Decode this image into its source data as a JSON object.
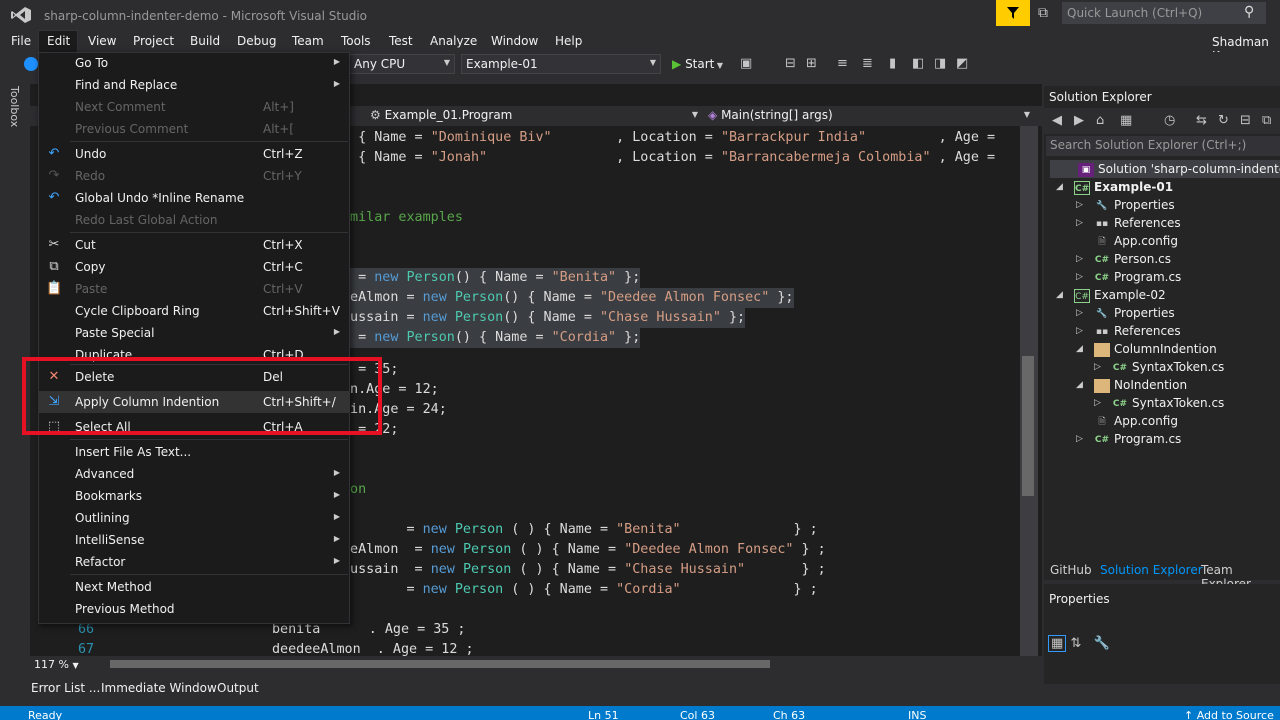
{
  "window": {
    "title": "sharp-column-indenter-demo - Microsoft Visual Studio",
    "quick_launch_placeholder": "Quick Launch (Ctrl+Q)",
    "user": "Shadman Ku"
  },
  "menubar": [
    "File",
    "Edit",
    "View",
    "Project",
    "Build",
    "Debug",
    "Team",
    "Tools",
    "Test",
    "Analyze",
    "Window",
    "Help"
  ],
  "toolbar": {
    "platform": "Any CPU",
    "startup_project": "Example-01",
    "start_label": "Start"
  },
  "left_rail": {
    "toolbox": "Toolbox"
  },
  "editor": {
    "nav_class": "Example_01.Program",
    "nav_member": "Main(string[] args)",
    "zoom": "117 %"
  },
  "code_lines": [
    {
      "n": "",
      "parts": [
        [
          "pl",
          "n { Name = "
        ],
        [
          "str",
          "\"Dominique Biv\""
        ],
        [
          "pl",
          "        , Location = "
        ],
        [
          "str",
          "\"Barrackpur India\""
        ],
        [
          "pl",
          "         , Age ="
        ]
      ]
    },
    {
      "n": "",
      "parts": [
        [
          "pl",
          "n { Name = "
        ],
        [
          "str",
          "\"Jonah\""
        ],
        [
          "pl",
          "                , Location = "
        ],
        [
          "str",
          "\"Barrancabermeja Colombia\""
        ],
        [
          "pl",
          " , Age ="
        ]
      ]
    },
    {
      "n": "",
      "parts": [
        [
          "cmt",
          "imilar examples"
        ]
      ]
    },
    {
      "n": "",
      "parts": [
        [
          "cmt",
          "n"
        ]
      ]
    },
    {
      "n": "",
      "parts": [
        [
          "pl",
          "a = "
        ],
        [
          "kw",
          "new"
        ],
        [
          "pl",
          " "
        ],
        [
          "ty",
          "Person"
        ],
        [
          "pl",
          "() { Name = "
        ],
        [
          "str",
          "\"Benita\""
        ],
        [
          "pl",
          " };"
        ]
      ]
    },
    {
      "n": "",
      "parts": [
        [
          "pl",
          "eeAlmon = "
        ],
        [
          "kw",
          "new"
        ],
        [
          "pl",
          " "
        ],
        [
          "ty",
          "Person"
        ],
        [
          "pl",
          "() { Name = "
        ],
        [
          "str",
          "\"Deedee Almon Fonsec\""
        ],
        [
          "pl",
          " };"
        ]
      ]
    },
    {
      "n": "",
      "parts": [
        [
          "pl",
          "Hussain = "
        ],
        [
          "kw",
          "new"
        ],
        [
          "pl",
          " "
        ],
        [
          "ty",
          "Person"
        ],
        [
          "pl",
          "() { Name = "
        ],
        [
          "str",
          "\"Chase Hussain\""
        ],
        [
          "pl",
          " };"
        ]
      ]
    },
    {
      "n": "",
      "parts": [
        [
          "pl",
          "a = "
        ],
        [
          "kw",
          "new"
        ],
        [
          "pl",
          " "
        ],
        [
          "ty",
          "Person"
        ],
        [
          "pl",
          "() { Name = "
        ],
        [
          "str",
          "\"Cordia\""
        ],
        [
          "pl",
          " };"
        ]
      ]
    },
    {
      "n": "",
      "parts": [
        [
          "pl",
          "e = 35;"
        ]
      ]
    },
    {
      "n": "",
      "parts": [
        [
          "pl",
          "on.Age = 12;"
        ]
      ]
    },
    {
      "n": "",
      "parts": [
        [
          "pl",
          "ain.Age = 24;"
        ]
      ]
    },
    {
      "n": "",
      "parts": [
        [
          "pl",
          "e = 22;"
        ]
      ]
    },
    {
      "n": "",
      "parts": [
        [
          "cmt",
          "ion"
        ]
      ]
    },
    {
      "n": "",
      "parts": [
        [
          "pl",
          "a       = "
        ],
        [
          "kw",
          "new"
        ],
        [
          "pl",
          " "
        ],
        [
          "ty",
          "Person"
        ],
        [
          "pl",
          " ( ) { Name = "
        ],
        [
          "str",
          "\"Benita\""
        ],
        [
          "pl",
          "              } ;"
        ]
      ]
    },
    {
      "n": "",
      "parts": [
        [
          "pl",
          "eeAlmon  = "
        ],
        [
          "kw",
          "new"
        ],
        [
          "pl",
          " "
        ],
        [
          "ty",
          "Person"
        ],
        [
          "pl",
          " ( ) { Name = "
        ],
        [
          "str",
          "\"Deedee Almon Fonsec\""
        ],
        [
          "pl",
          " } ;"
        ]
      ]
    },
    {
      "n": "",
      "parts": [
        [
          "pl",
          "Hussain  = "
        ],
        [
          "kw",
          "new"
        ],
        [
          "pl",
          " "
        ],
        [
          "ty",
          "Person"
        ],
        [
          "pl",
          " ( ) { Name = "
        ],
        [
          "str",
          "\"Chase Hussain\""
        ],
        [
          "pl",
          "       } ;"
        ]
      ]
    },
    {
      "n": "",
      "parts": [
        [
          "pl",
          "a       = "
        ],
        [
          "kw",
          "new"
        ],
        [
          "pl",
          " "
        ],
        [
          "ty",
          "Person"
        ],
        [
          "pl",
          " ( ) { Name = "
        ],
        [
          "str",
          "\"Cordia\""
        ],
        [
          "pl",
          "              } ;"
        ]
      ]
    },
    {
      "n": "66",
      "parts": [
        [
          "pl",
          "benita      . Age = 35 ;"
        ]
      ]
    },
    {
      "n": "67",
      "parts": [
        [
          "pl",
          "deedeeAlmon  . Age = 12 ;"
        ]
      ]
    }
  ],
  "edit_menu": {
    "items": [
      {
        "label": "Go To",
        "shortcut": "",
        "sub": true,
        "disabled": false,
        "icon": ""
      },
      {
        "label": "Find and Replace",
        "shortcut": "",
        "sub": true,
        "disabled": false,
        "icon": ""
      },
      {
        "label": "Next Comment",
        "shortcut": "Alt+]",
        "sub": false,
        "disabled": true,
        "icon": ""
      },
      {
        "label": "Previous Comment",
        "shortcut": "Alt+[",
        "sub": false,
        "disabled": true,
        "icon": ""
      },
      {
        "label": "Undo",
        "shortcut": "Ctrl+Z",
        "sub": false,
        "disabled": false,
        "icon": "undo-icon"
      },
      {
        "label": "Redo",
        "shortcut": "Ctrl+Y",
        "sub": false,
        "disabled": true,
        "icon": "redo-icon"
      },
      {
        "label": "Global Undo *Inline Rename",
        "shortcut": "",
        "sub": false,
        "disabled": false,
        "icon": "global-undo-icon"
      },
      {
        "label": "Redo Last Global Action",
        "shortcut": "",
        "sub": false,
        "disabled": true,
        "icon": ""
      },
      {
        "label": "Cut",
        "shortcut": "Ctrl+X",
        "sub": false,
        "disabled": false,
        "icon": "cut-icon"
      },
      {
        "label": "Copy",
        "shortcut": "Ctrl+C",
        "sub": false,
        "disabled": false,
        "icon": "copy-icon"
      },
      {
        "label": "Paste",
        "shortcut": "Ctrl+V",
        "sub": false,
        "disabled": true,
        "icon": "paste-icon"
      },
      {
        "label": "Cycle Clipboard Ring",
        "shortcut": "Ctrl+Shift+V",
        "sub": false,
        "disabled": false,
        "icon": ""
      },
      {
        "label": "Paste Special",
        "shortcut": "",
        "sub": true,
        "disabled": false,
        "icon": ""
      },
      {
        "label": "Duplicate",
        "shortcut": "Ctrl+D",
        "sub": false,
        "disabled": false,
        "icon": ""
      },
      {
        "label": "Delete",
        "shortcut": "Del",
        "sub": false,
        "disabled": false,
        "icon": "delete-icon"
      },
      {
        "label": "Apply Column Indention",
        "shortcut": "Ctrl+Shift+/",
        "sub": false,
        "disabled": false,
        "icon": "column-indent-icon",
        "highlighted": true
      },
      {
        "label": "Select All",
        "shortcut": "Ctrl+A",
        "sub": false,
        "disabled": false,
        "icon": "select-all-icon"
      },
      {
        "label": "Insert File As Text...",
        "shortcut": "",
        "sub": false,
        "disabled": false,
        "icon": ""
      },
      {
        "label": "Advanced",
        "shortcut": "",
        "sub": true,
        "disabled": false,
        "icon": ""
      },
      {
        "label": "Bookmarks",
        "shortcut": "",
        "sub": true,
        "disabled": false,
        "icon": ""
      },
      {
        "label": "Outlining",
        "shortcut": "",
        "sub": true,
        "disabled": false,
        "icon": ""
      },
      {
        "label": "IntelliSense",
        "shortcut": "",
        "sub": true,
        "disabled": false,
        "icon": ""
      },
      {
        "label": "Refactor",
        "shortcut": "",
        "sub": true,
        "disabled": false,
        "icon": ""
      },
      {
        "label": "Next Method",
        "shortcut": "",
        "sub": false,
        "disabled": false,
        "icon": ""
      },
      {
        "label": "Previous Method",
        "shortcut": "",
        "sub": false,
        "disabled": false,
        "icon": ""
      }
    ]
  },
  "solution_explorer": {
    "title": "Solution Explorer",
    "search_placeholder": "Search Solution Explorer (Ctrl+;)",
    "tree": [
      {
        "label": "Solution 'sharp-column-indenter-dem",
        "icon": "solution-icon",
        "arrow": "",
        "bold": false
      },
      {
        "label": "Example-01",
        "icon": "csharp-project-icon",
        "arrow": "open",
        "bold": true
      },
      {
        "label": "Properties",
        "icon": "wrench-icon",
        "arrow": "closed",
        "bold": false
      },
      {
        "label": "References",
        "icon": "references-icon",
        "arrow": "closed",
        "bold": false
      },
      {
        "label": "App.config",
        "icon": "config-file-icon",
        "arrow": "",
        "bold": false
      },
      {
        "label": "Person.cs",
        "icon": "csharp-file-icon",
        "arrow": "closed",
        "bold": false
      },
      {
        "label": "Program.cs",
        "icon": "csharp-file-icon",
        "arrow": "closed",
        "bold": false
      },
      {
        "label": "Example-02",
        "icon": "csharp-project-icon",
        "arrow": "open",
        "bold": false
      },
      {
        "label": "Properties",
        "icon": "wrench-icon",
        "arrow": "closed",
        "bold": false
      },
      {
        "label": "References",
        "icon": "references-icon",
        "arrow": "closed",
        "bold": false
      },
      {
        "label": "ColumnIndention",
        "icon": "folder-icon",
        "arrow": "open",
        "bold": false
      },
      {
        "label": "SyntaxToken.cs",
        "icon": "csharp-file-icon",
        "arrow": "closed",
        "bold": false
      },
      {
        "label": "NoIndention",
        "icon": "folder-icon",
        "arrow": "open",
        "bold": false
      },
      {
        "label": "SyntaxToken.cs",
        "icon": "csharp-file-icon",
        "arrow": "closed",
        "bold": false
      },
      {
        "label": "App.config",
        "icon": "config-file-icon",
        "arrow": "",
        "bold": false
      },
      {
        "label": "Program.cs",
        "icon": "csharp-file-icon",
        "arrow": "closed",
        "bold": false
      }
    ],
    "tabs": [
      "GitHub",
      "Solution Explorer",
      "Team Explorer"
    ]
  },
  "properties_panel": {
    "title": "Properties"
  },
  "bottom_tabs": [
    "Error List ...",
    "Immediate Window",
    "Output"
  ],
  "status_bar": {
    "state": "Ready",
    "line": "Ln 51",
    "col": "Col 63",
    "ch": "Ch 63",
    "mode": "INS",
    "source_control": "Add to Source"
  },
  "colors": {
    "accent": "#007acc",
    "highlight_box": "#e81123",
    "filter_badge": "#ffcc00"
  }
}
